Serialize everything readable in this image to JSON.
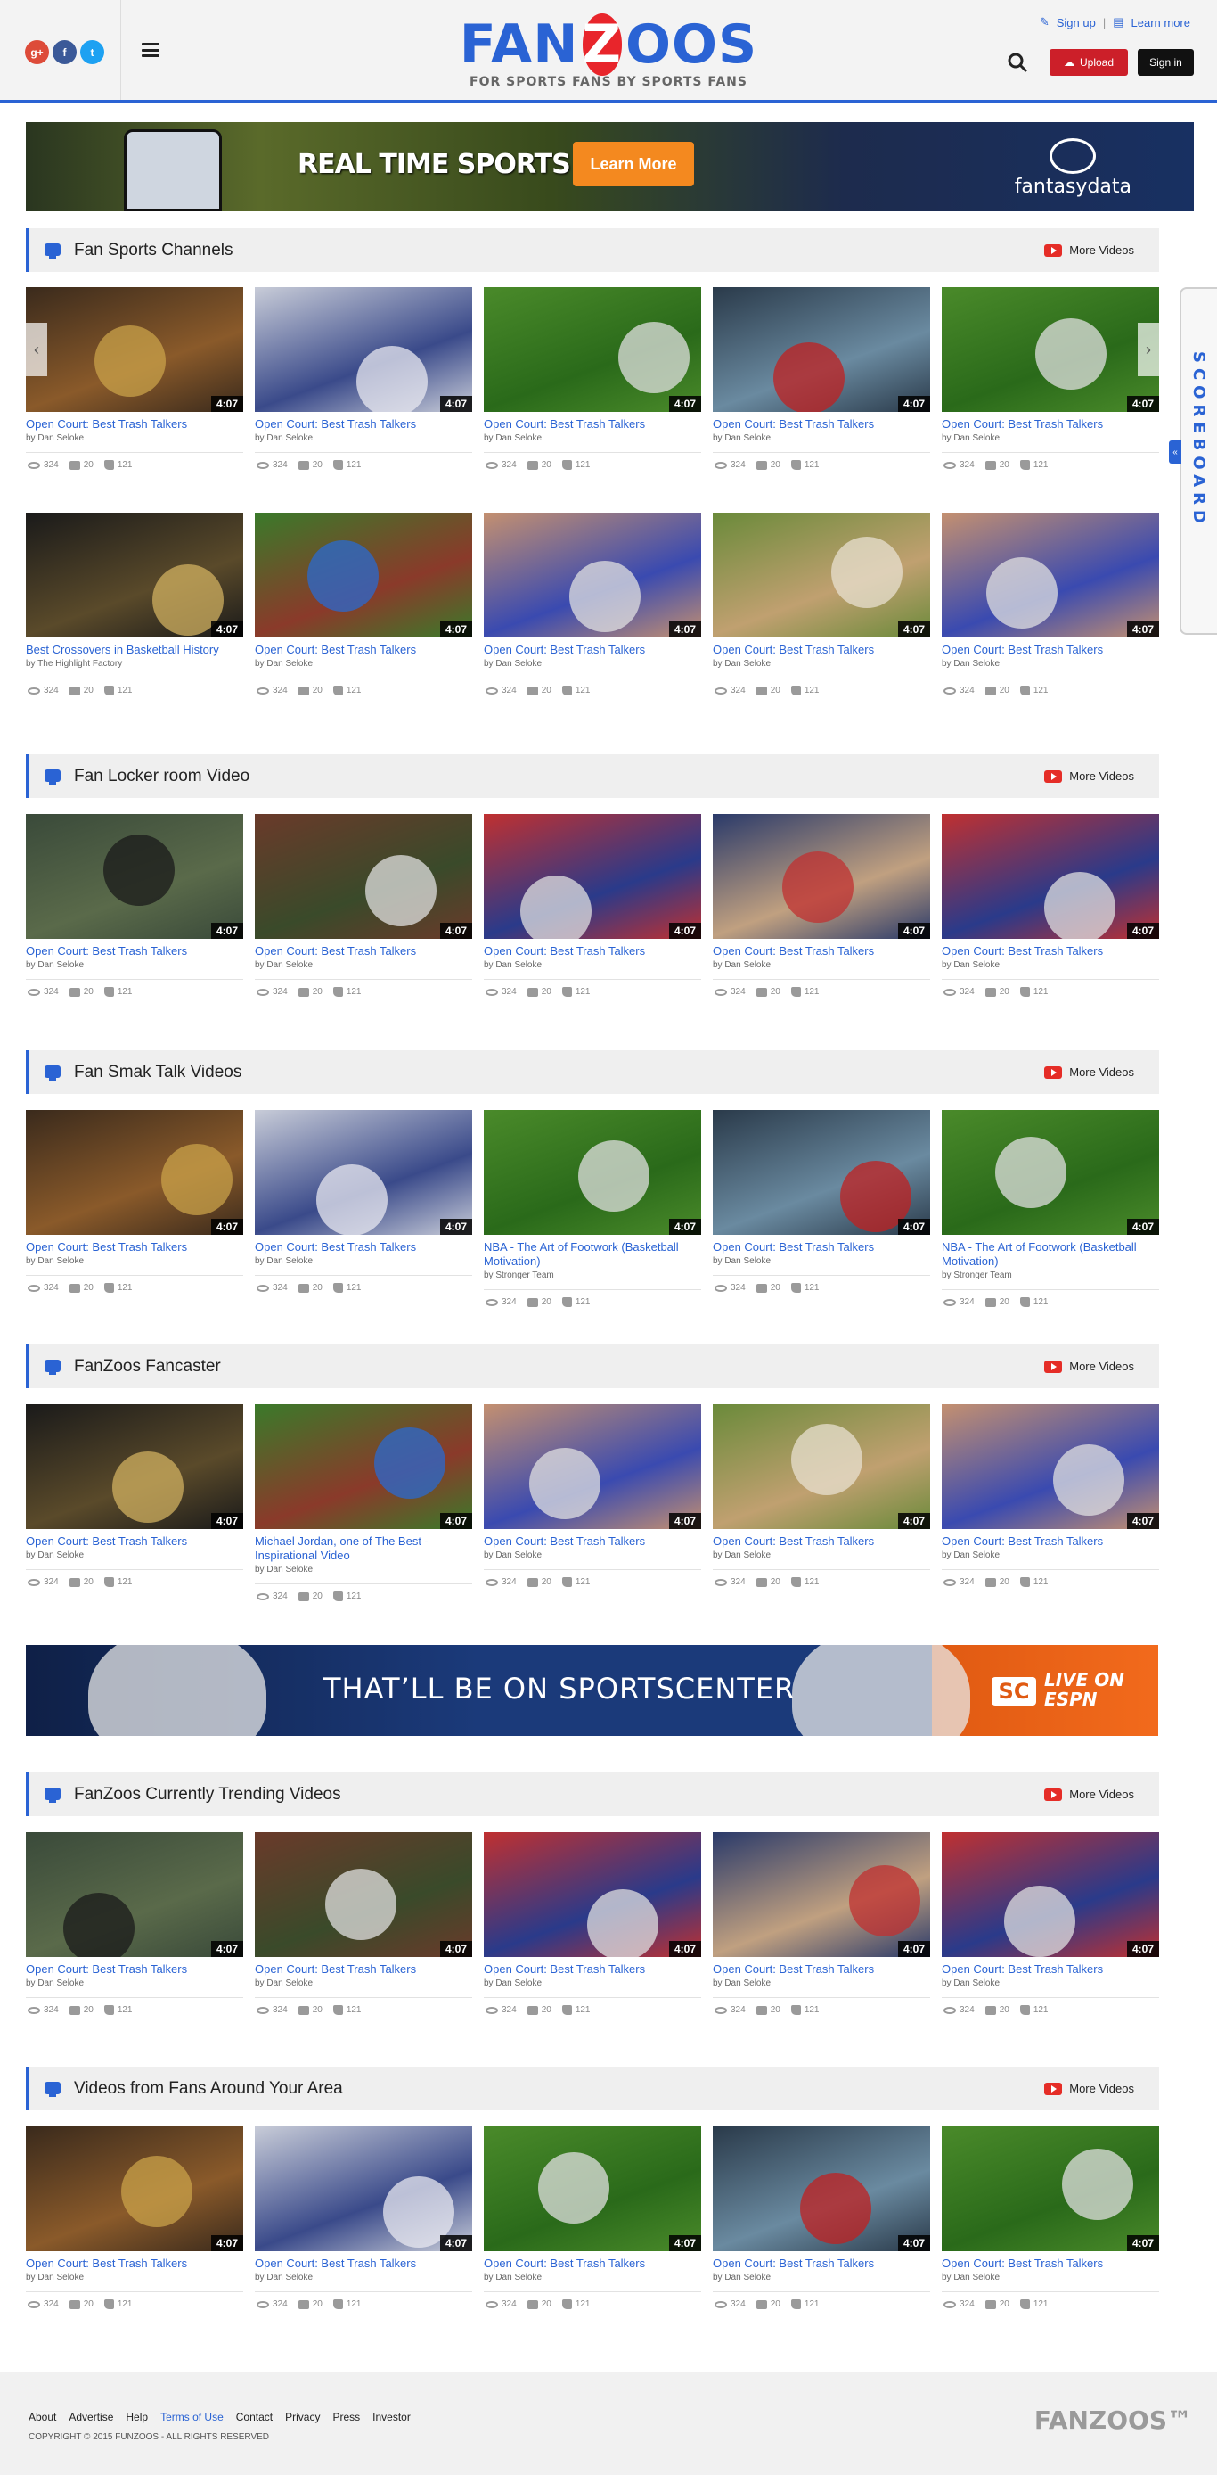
{
  "header": {
    "social": [
      "g+",
      "f",
      "t"
    ],
    "logo": {
      "left": "FAN",
      "z": "Z",
      "right": "OOS",
      "tagline": "FOR SPORTS FANS BY SPORTS FANS"
    },
    "signup": "Sign up",
    "learn_more": "Learn more",
    "upload": "Upload",
    "signin": "Sign in"
  },
  "top_banner": {
    "text": "REAL TIME SPORTS DATA",
    "button": "Learn More",
    "brand": "fantasydata"
  },
  "scoreboard": {
    "label": "SCOREBOARD",
    "tab": "«"
  },
  "more_videos": "More Videos",
  "sections": [
    {
      "title": "Fan Sports Channels",
      "rows": [
        [
          {
            "title": "Open Court: Best Trash Talkers",
            "by": "by Dan Seloke",
            "duration": "4:07",
            "views": "324",
            "comments": "20",
            "likes": "121"
          },
          {
            "title": "Open Court: Best Trash Talkers",
            "by": "by Dan Seloke",
            "duration": "4:07",
            "views": "324",
            "comments": "20",
            "likes": "121"
          },
          {
            "title": "Open Court: Best Trash Talkers",
            "by": "by Dan Seloke",
            "duration": "4:07",
            "views": "324",
            "comments": "20",
            "likes": "121"
          },
          {
            "title": "Open Court: Best Trash Talkers",
            "by": "by Dan Seloke",
            "duration": "4:07",
            "views": "324",
            "comments": "20",
            "likes": "121"
          },
          {
            "title": "Open Court: Best Trash Talkers",
            "by": "by Dan Seloke",
            "duration": "4:07",
            "views": "324",
            "comments": "20",
            "likes": "121"
          }
        ],
        [
          {
            "title": "Best Crossovers in Basketball History",
            "by": "by The Highlight Factory",
            "duration": "4:07",
            "views": "324",
            "comments": "20",
            "likes": "121"
          },
          {
            "title": "Open Court: Best Trash Talkers",
            "by": "by Dan Seloke",
            "duration": "4:07",
            "views": "324",
            "comments": "20",
            "likes": "121"
          },
          {
            "title": "Open Court: Best Trash Talkers",
            "by": "by Dan Seloke",
            "duration": "4:07",
            "views": "324",
            "comments": "20",
            "likes": "121"
          },
          {
            "title": "Open Court: Best Trash Talkers",
            "by": "by Dan Seloke",
            "duration": "4:07",
            "views": "324",
            "comments": "20",
            "likes": "121"
          },
          {
            "title": "Open Court: Best Trash Talkers",
            "by": "by Dan Seloke",
            "duration": "4:07",
            "views": "324",
            "comments": "20",
            "likes": "121"
          }
        ]
      ]
    },
    {
      "title": "Fan Locker room Video",
      "rows": [
        [
          {
            "title": "Open Court: Best Trash Talkers",
            "by": "by Dan Seloke",
            "duration": "4:07",
            "views": "324",
            "comments": "20",
            "likes": "121"
          },
          {
            "title": "Open Court: Best Trash Talkers",
            "by": "by Dan Seloke",
            "duration": "4:07",
            "views": "324",
            "comments": "20",
            "likes": "121"
          },
          {
            "title": "Open Court: Best Trash Talkers",
            "by": "by Dan Seloke",
            "duration": "4:07",
            "views": "324",
            "comments": "20",
            "likes": "121"
          },
          {
            "title": "Open Court: Best Trash Talkers",
            "by": "by Dan Seloke",
            "duration": "4:07",
            "views": "324",
            "comments": "20",
            "likes": "121"
          },
          {
            "title": "Open Court: Best Trash Talkers",
            "by": "by Dan Seloke",
            "duration": "4:07",
            "views": "324",
            "comments": "20",
            "likes": "121"
          }
        ]
      ]
    },
    {
      "title": "Fan Smak Talk Videos",
      "rows": [
        [
          {
            "title": "Open Court: Best Trash Talkers",
            "by": "by Dan Seloke",
            "duration": "4:07",
            "views": "324",
            "comments": "20",
            "likes": "121"
          },
          {
            "title": "Open Court: Best Trash Talkers",
            "by": "by Dan Seloke",
            "duration": "4:07",
            "views": "324",
            "comments": "20",
            "likes": "121"
          },
          {
            "title": "NBA - The Art of Footwork (Basketball Motivation)",
            "by": "by Stronger Team",
            "duration": "4:07",
            "views": "324",
            "comments": "20",
            "likes": "121"
          },
          {
            "title": "Open Court: Best Trash Talkers",
            "by": "by Dan Seloke",
            "duration": "4:07",
            "views": "324",
            "comments": "20",
            "likes": "121"
          },
          {
            "title": "NBA - The Art of Footwork (Basketball Motivation)",
            "by": "by Stronger Team",
            "duration": "4:07",
            "views": "324",
            "comments": "20",
            "likes": "121"
          }
        ]
      ]
    },
    {
      "title": "FanZoos Fancaster",
      "rows": [
        [
          {
            "title": "Open Court: Best Trash Talkers",
            "by": "by Dan Seloke",
            "duration": "4:07",
            "views": "324",
            "comments": "20",
            "likes": "121"
          },
          {
            "title": "Michael Jordan, one of The Best - Inspirational Video",
            "by": "by Dan Seloke",
            "duration": "4:07",
            "views": "324",
            "comments": "20",
            "likes": "121"
          },
          {
            "title": "Open Court: Best Trash Talkers",
            "by": "by Dan Seloke",
            "duration": "4:07",
            "views": "324",
            "comments": "20",
            "likes": "121"
          },
          {
            "title": "Open Court: Best Trash Talkers",
            "by": "by Dan Seloke",
            "duration": "4:07",
            "views": "324",
            "comments": "20",
            "likes": "121"
          },
          {
            "title": "Open Court: Best Trash Talkers",
            "by": "by Dan Seloke",
            "duration": "4:07",
            "views": "324",
            "comments": "20",
            "likes": "121"
          }
        ]
      ]
    },
    {
      "title": "FanZoos Currently Trending Videos",
      "rows": [
        [
          {
            "title": "Open Court: Best Trash Talkers",
            "by": "by Dan Seloke",
            "duration": "4:07",
            "views": "324",
            "comments": "20",
            "likes": "121"
          },
          {
            "title": "Open Court: Best Trash Talkers",
            "by": "by Dan Seloke",
            "duration": "4:07",
            "views": "324",
            "comments": "20",
            "likes": "121"
          },
          {
            "title": "Open Court: Best Trash Talkers",
            "by": "by Dan Seloke",
            "duration": "4:07",
            "views": "324",
            "comments": "20",
            "likes": "121"
          },
          {
            "title": "Open Court: Best Trash Talkers",
            "by": "by Dan Seloke",
            "duration": "4:07",
            "views": "324",
            "comments": "20",
            "likes": "121"
          },
          {
            "title": "Open Court: Best Trash Talkers",
            "by": "by Dan Seloke",
            "duration": "4:07",
            "views": "324",
            "comments": "20",
            "likes": "121"
          }
        ]
      ]
    },
    {
      "title": "Videos from Fans Around Your Area",
      "rows": [
        [
          {
            "title": "Open Court: Best Trash Talkers",
            "by": "by Dan Seloke",
            "duration": "4:07",
            "views": "324",
            "comments": "20",
            "likes": "121"
          },
          {
            "title": "Open Court: Best Trash Talkers",
            "by": "by Dan Seloke",
            "duration": "4:07",
            "views": "324",
            "comments": "20",
            "likes": "121"
          },
          {
            "title": "Open Court: Best Trash Talkers",
            "by": "by Dan Seloke",
            "duration": "4:07",
            "views": "324",
            "comments": "20",
            "likes": "121"
          },
          {
            "title": "Open Court: Best Trash Talkers",
            "by": "by Dan Seloke",
            "duration": "4:07",
            "views": "324",
            "comments": "20",
            "likes": "121"
          },
          {
            "title": "Open Court: Best Trash Talkers",
            "by": "by Dan Seloke",
            "duration": "4:07",
            "views": "324",
            "comments": "20",
            "likes": "121"
          }
        ]
      ]
    }
  ],
  "espn_ad": {
    "text": "THAT’LL BE ON SPORTSCENTER",
    "sc": "SC",
    "live": "LIVE ON",
    "brand": "ESPN"
  },
  "footer": {
    "links": [
      "About",
      "Advertise",
      "Help",
      "Terms of Use",
      "Contact",
      "Privacy",
      "Press",
      "Investor"
    ],
    "copyright": "COPYRIGHT © 2015 FUNZOOS - ALL RIGHTS RESERVED",
    "logo": "FANZOOS™"
  },
  "colors": {
    "brand_blue": "#2a63d4",
    "brand_red": "#e8252b",
    "upload_red": "#cc1f29"
  }
}
